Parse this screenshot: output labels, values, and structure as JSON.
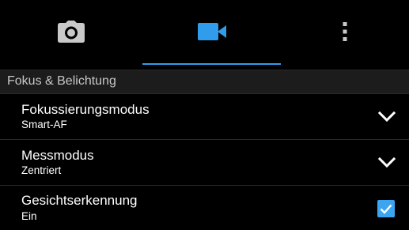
{
  "tabs": [
    {
      "icon": "camera-icon",
      "selected": false
    },
    {
      "icon": "video-icon",
      "selected": true
    },
    {
      "icon": "more-vert-icon",
      "selected": false
    }
  ],
  "colors": {
    "accent": "#2f9dec",
    "checkbox": "#3da5f0",
    "background": "#000000",
    "section_background": "#1c1c1c"
  },
  "section": {
    "title": "Fokus & Belichtung"
  },
  "settings": [
    {
      "title": "Fokussierungsmodus",
      "value": "Smart-AF",
      "control": "chevron-down-icon"
    },
    {
      "title": "Messmodus",
      "value": "Zentriert",
      "control": "chevron-down-icon"
    },
    {
      "title": "Gesichtserkennung",
      "value": "Ein",
      "control": "checkbox",
      "checked": true
    }
  ]
}
